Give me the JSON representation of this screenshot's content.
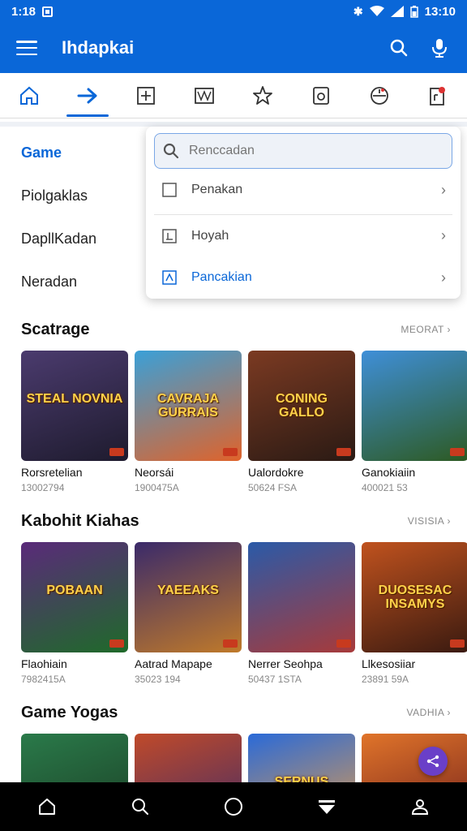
{
  "status_bar": {
    "time_left": "1:18",
    "time_right": "13:10"
  },
  "app_bar": {
    "title": "Ihdapkai"
  },
  "tabs": [
    {
      "icon": "home-icon",
      "active": false
    },
    {
      "icon": "arrow-right-icon",
      "active": true
    },
    {
      "icon": "plus-box-icon",
      "active": false
    },
    {
      "icon": "image-box-icon",
      "active": false
    },
    {
      "icon": "star-icon",
      "active": false
    },
    {
      "icon": "camera-icon",
      "active": false
    },
    {
      "icon": "clock-icon",
      "active": false
    },
    {
      "icon": "notification-icon",
      "active": false
    }
  ],
  "side_menu": [
    {
      "label": "Game",
      "active": true
    },
    {
      "label": "Piolgaklas",
      "active": false
    },
    {
      "label": "DapllKadan",
      "active": false
    },
    {
      "label": "Neradan",
      "active": false
    }
  ],
  "dropdown": {
    "search_placeholder": "Renccadan",
    "items": [
      {
        "label": "Penakan"
      },
      {
        "label": "Hoyah"
      },
      {
        "label": "Pancakian"
      }
    ]
  },
  "sections": [
    {
      "title": "Scatrage",
      "see_more": "MEORAT",
      "cards": [
        {
          "name": "Rorsretelian",
          "sub": "13002794",
          "logo": "STEAL NOVNIA",
          "colors": [
            "#4b3b6e",
            "#1e1b2e"
          ]
        },
        {
          "name": "Neorsái",
          "sub": "1900475A",
          "logo": "CAVRAJA GURRAIS",
          "colors": [
            "#3aa0d8",
            "#e0632a"
          ]
        },
        {
          "name": "Ualordokre",
          "sub": "50624 FSA",
          "logo": "CONING GALLO",
          "colors": [
            "#7b3a22",
            "#2a1a14"
          ]
        },
        {
          "name": "Ganokiaiin",
          "sub": "400021 53",
          "logo": "",
          "colors": [
            "#3f8fd8",
            "#2d5a22"
          ]
        }
      ]
    },
    {
      "title": "Kabohit Kiahas",
      "see_more": "VISISIA",
      "cards": [
        {
          "name": "Flaohiain",
          "sub": "7982415A",
          "logo": "POBAAN",
          "colors": [
            "#5a2a7a",
            "#1f6a2a"
          ]
        },
        {
          "name": "Aatrad Mapape",
          "sub": "35023 194",
          "logo": "YAEEAKS",
          "colors": [
            "#3a2a6a",
            "#c07a2a"
          ]
        },
        {
          "name": "Nerrer Seohpa",
          "sub": "50437 1STA",
          "logo": "",
          "colors": [
            "#2a5aa8",
            "#a83a3a"
          ]
        },
        {
          "name": "Llkesosiiar",
          "sub": "23891 59A",
          "logo": "DUOSESAC INSAMYS",
          "colors": [
            "#c0521e",
            "#3a1a10"
          ]
        }
      ]
    },
    {
      "title": "Game Yogas",
      "see_more": "VADHIA",
      "cards": [
        {
          "name": "",
          "sub": "",
          "logo": "",
          "colors": [
            "#2a7a4a",
            "#1a3a22"
          ]
        },
        {
          "name": "",
          "sub": "",
          "logo": "",
          "colors": [
            "#c04a2a",
            "#3a2a6a"
          ]
        },
        {
          "name": "",
          "sub": "",
          "logo": "SERNUS",
          "colors": [
            "#2a6ad8",
            "#f0a040"
          ]
        },
        {
          "name": "",
          "sub": "",
          "logo": "",
          "colors": [
            "#e0742a",
            "#6a1a1a"
          ]
        }
      ]
    }
  ],
  "bottom_nav": [
    {
      "icon": "home-icon"
    },
    {
      "icon": "search-icon"
    },
    {
      "icon": "circle-icon"
    },
    {
      "icon": "download-icon"
    },
    {
      "icon": "profile-icon"
    }
  ]
}
